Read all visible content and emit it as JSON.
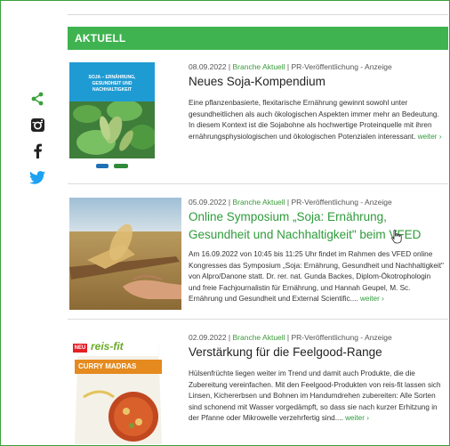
{
  "section": {
    "title": "AKTUELL"
  },
  "social": [
    {
      "name": "share-icon",
      "color": "#3aa13a"
    },
    {
      "name": "instagram-icon",
      "color": "#222222"
    },
    {
      "name": "facebook-icon",
      "color": "#222222"
    },
    {
      "name": "twitter-icon",
      "color": "#1da1f2"
    }
  ],
  "articles": [
    {
      "date": "08.09.2022",
      "category": "Branche Aktuell",
      "tag": "PR-Veröffentlichung - Anzeige",
      "title": "Neues Soja-Kompendium",
      "text": "Eine pflanzenbasierte, flexitarische Ernährung gewinnt sowohl unter gesundheitlichen als auch ökologischen Aspekten immer mehr an Bedeutung. In diesem Kontext ist die Sojabohne als hochwertige Proteinquelle mit ihren ernährungsphysiologischen und ökologischen Potenzialen interessant.",
      "more": "weiter ›",
      "thumb_title": "SOJA – ERNÄHRUNG, GESUNDHEIT UND NACHHALTIGKEIT"
    },
    {
      "date": "05.09.2022",
      "category": "Branche Aktuell",
      "tag": "PR-Veröffentlichung - Anzeige",
      "title": "Online Symposium „Soja: Ernährung, Gesundheit und Nachhaltigkeit\" beim VFED",
      "text": "Am 16.09.2022 von 10:45 bis 11:25 Uhr findet im Rahmen des VFED online Kongresses das Symposium „Soja: Ernährung, Gesundheit und Nachhaltigkeit\" von Alpro/Danone statt. Dr. rer. nat. Gunda Backes, Diplom-Ökotrophologin und freie Fachjournalistin für Ernährung, und Hannah Geupel, M. Sc. Ernährung und Gesundheit und External Scientific....",
      "more": "weiter ›"
    },
    {
      "date": "02.09.2022",
      "category": "Branche Aktuell",
      "tag": "PR-Veröffentlichung - Anzeige",
      "title": "Verstärkung für die Feelgood-Range",
      "text": "Hülsenfrüchte liegen weiter im Trend und damit auch Produkte, die die Zubereitung vereinfachen. Mit den Feelgood-Produkten von reis-fit lassen sich Linsen, Kichererbsen und Bohnen im Handumdrehen zubereiten: Alle Sorten sind schonend mit Wasser vorgedämpft, so dass sie nach kurzer Erhitzung in der Pfanne oder Mikrowelle verzehrfertig sind....",
      "more": "weiter ›",
      "pack_badge": "NEU",
      "pack_brand": "reis-fit",
      "pack_variant": "CURRY MADRAS"
    }
  ]
}
